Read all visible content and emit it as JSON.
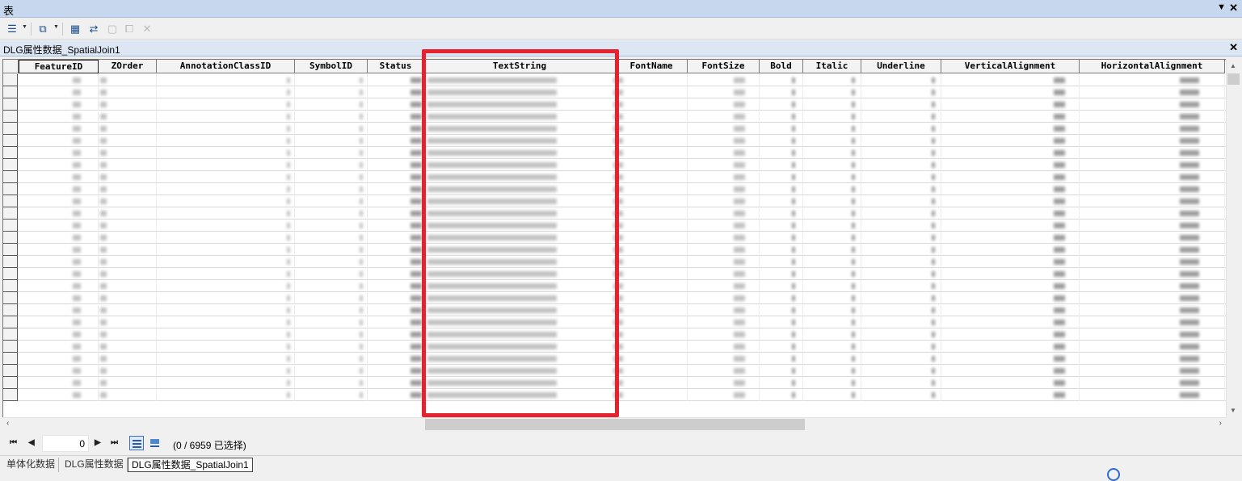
{
  "window": {
    "title": "表",
    "pin_glyph": "⊓",
    "close_glyph": "✕"
  },
  "toolbar": {
    "icons": [
      "table-options-icon",
      "related-tables-icon",
      "select-by-attributes-icon",
      "switch-selection-icon",
      "clear-selection-icon",
      "zoom-to-selected-icon",
      "delete-selected-icon"
    ]
  },
  "table": {
    "title": "DLG属性数据_SpatialJoin1",
    "columns": [
      "FeatureID",
      "ZOrder",
      "AnnotationClassID",
      "SymbolID",
      "Status",
      "TextString",
      "FontName",
      "FontSize",
      "Bold",
      "Italic",
      "Underline",
      "VerticalAlignment",
      "HorizontalAlignment"
    ],
    "selected_column": "TextString",
    "highlight_color": "#e5222e",
    "visible_rows": 27,
    "cell_values_note": ""
  },
  "navigation": {
    "first": "⏮",
    "prev": "◀",
    "next": "▶",
    "last": "⏭",
    "current_record": "0",
    "status": "(0 / 6959 已选择)"
  },
  "tabs": [
    {
      "label": "单体化数据",
      "active": false
    },
    {
      "label": "DLG属性数据",
      "active": false
    },
    {
      "label": "DLG属性数据_SpatialJoin1",
      "active": true
    }
  ]
}
